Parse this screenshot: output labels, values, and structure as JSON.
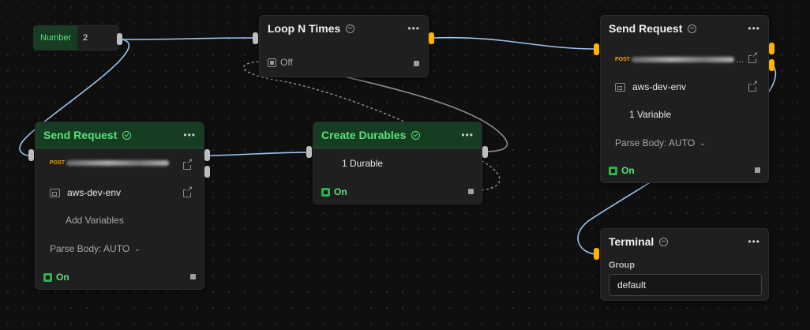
{
  "number_node": {
    "label": "Number",
    "value": "2"
  },
  "loop_node": {
    "title": "Loop N Times",
    "toggle_label": "Off"
  },
  "send_request_left": {
    "title": "Send Request",
    "method": "POST",
    "environment": "aws-dev-env",
    "variables_label": "Add Variables",
    "parse_body_label": "Parse Body: AUTO",
    "toggle_label": "On"
  },
  "create_durables": {
    "title": "Create Durables",
    "count_label": "1 Durable",
    "toggle_label": "On"
  },
  "send_request_right": {
    "title": "Send Request",
    "method": "POST",
    "environment": "aws-dev-env",
    "variables_label": "1 Variable",
    "parse_body_label": "Parse Body: AUTO",
    "toggle_label": "On"
  },
  "terminal_node": {
    "title": "Terminal",
    "group_label": "Group",
    "group_value": "default"
  },
  "icons": {
    "more": "more-horizontal-icon",
    "status_ok": "check-circle-icon",
    "status_idle": "minus-circle-icon",
    "external_link": "external-link-icon",
    "environment": "environment-icon",
    "toggle": "toggle-icon",
    "chevron": "chevron-down-icon"
  },
  "colors": {
    "canvas": "#0f0f0f",
    "node_bg": "#1f1f1f",
    "header_green": "#163d22",
    "title_green": "#5ce07c",
    "toggle_on": "#2bb24c",
    "port_yellow": "#ffb300",
    "wire_blue": "#9ec3f0",
    "wire_gray": "#8c8c8c",
    "post_badge": "#e8a200"
  }
}
